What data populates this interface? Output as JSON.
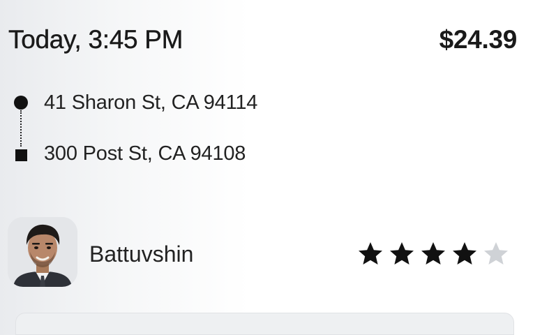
{
  "trip": {
    "time": "Today, 3:45 PM",
    "price": "$24.39"
  },
  "route": {
    "pickup": "41 Sharon St, CA 94114",
    "dropoff": "300 Post St, CA 94108"
  },
  "driver": {
    "name": "Battuvshin",
    "avatar_icon": "driver-photo",
    "rating": 4,
    "rating_max": 5
  },
  "colors": {
    "star_filled": "#111111",
    "star_empty": "#cfd2d6"
  }
}
